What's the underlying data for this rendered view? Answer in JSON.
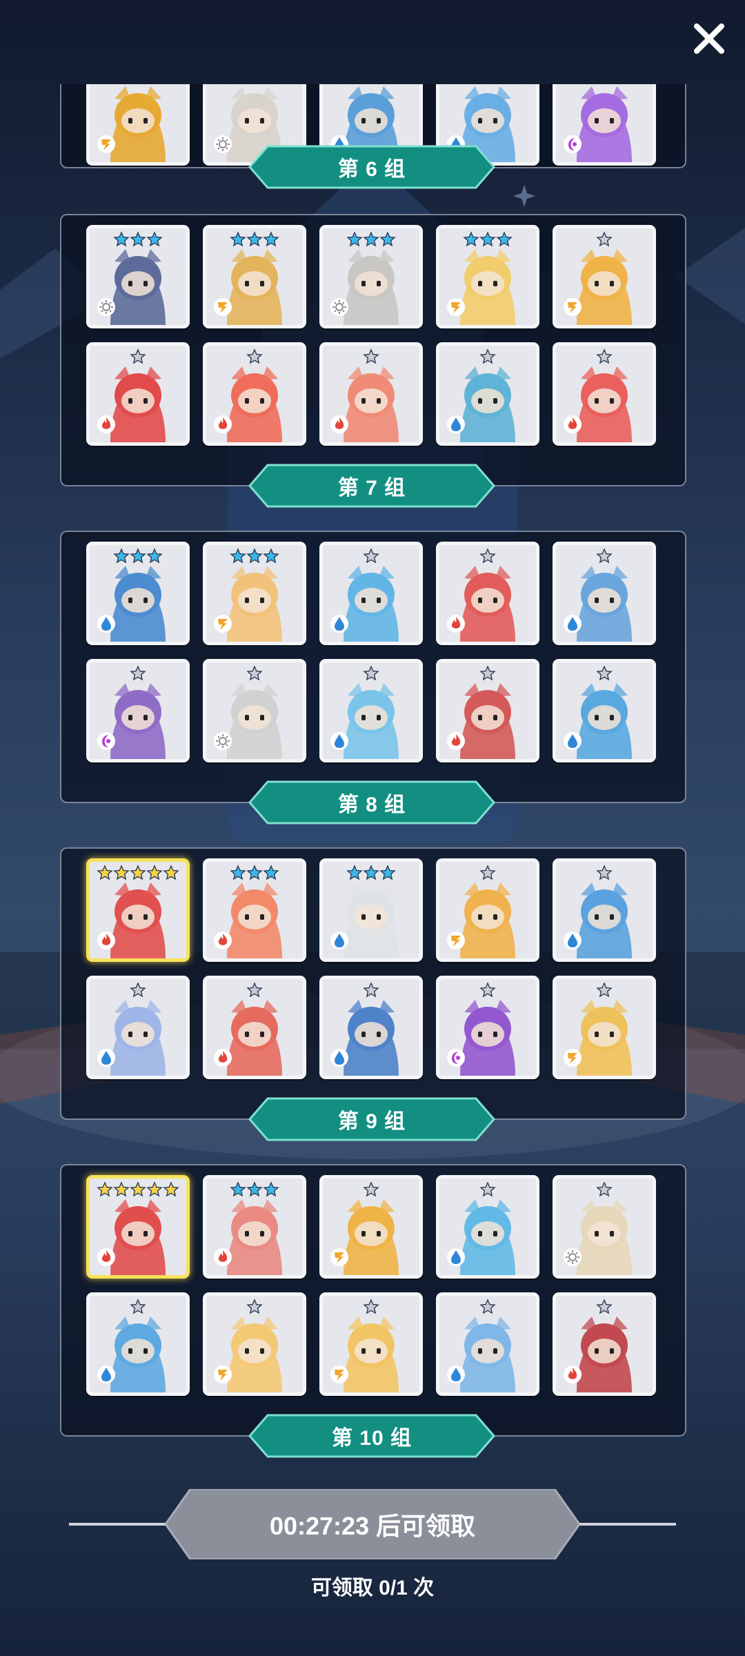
{
  "close_icon": "close-icon",
  "groups": [
    {
      "label": "第 6 组",
      "rows": [
        [
          {
            "el": "lightning",
            "body": "#e6a933",
            "stars": 0
          },
          {
            "el": "light",
            "body": "#d8d4cc",
            "stars": 0
          },
          {
            "el": "water",
            "body": "#5a9fd8",
            "stars": 0
          },
          {
            "el": "water",
            "body": "#6aaee6",
            "stars": 0
          },
          {
            "el": "dark",
            "body": "#a56be0",
            "stars": 0
          }
        ]
      ]
    },
    {
      "label": "第 7 组",
      "rows": [
        [
          {
            "el": "light",
            "body": "#5d6b9a",
            "stars": 3,
            "star": "blue"
          },
          {
            "el": "lightning",
            "body": "#e4b45c",
            "stars": 3,
            "star": "blue"
          },
          {
            "el": "light",
            "body": "#c9c7c4",
            "stars": 3,
            "star": "blue"
          },
          {
            "el": "lightning",
            "body": "#f2cd6d",
            "stars": 3,
            "star": "blue"
          },
          {
            "el": "lightning",
            "body": "#f0b347",
            "stars": 1,
            "star": "silver"
          }
        ],
        [
          {
            "el": "fire",
            "body": "#e24b4b",
            "stars": 1,
            "star": "silver"
          },
          {
            "el": "fire",
            "body": "#ef6d5a",
            "stars": 1,
            "star": "silver"
          },
          {
            "el": "fire",
            "body": "#f08b77",
            "stars": 1,
            "star": "silver"
          },
          {
            "el": "water",
            "body": "#5fb3d6",
            "stars": 1,
            "star": "silver"
          },
          {
            "el": "fire",
            "body": "#e9605c",
            "stars": 1,
            "star": "silver"
          }
        ]
      ]
    },
    {
      "label": "第 8 组",
      "rows": [
        [
          {
            "el": "water",
            "body": "#4c8cd0",
            "stars": 3,
            "star": "blue"
          },
          {
            "el": "lightning",
            "body": "#f2c27b",
            "stars": 3,
            "star": "blue"
          },
          {
            "el": "water",
            "body": "#63b5e6",
            "stars": 1,
            "star": "silver"
          },
          {
            "el": "fire",
            "body": "#e35c5c",
            "stars": 1,
            "star": "silver"
          },
          {
            "el": "water",
            "body": "#6aa6dd",
            "stars": 1,
            "star": "silver"
          }
        ],
        [
          {
            "el": "dark",
            "body": "#8f6cc7",
            "stars": 1,
            "star": "silver"
          },
          {
            "el": "light",
            "body": "#d1d1d1",
            "stars": 1,
            "star": "silver"
          },
          {
            "el": "water",
            "body": "#7ac4ea",
            "stars": 1,
            "star": "silver"
          },
          {
            "el": "fire",
            "body": "#d45a5a",
            "stars": 1,
            "star": "silver"
          },
          {
            "el": "water",
            "body": "#5aa8e0",
            "stars": 1,
            "star": "silver"
          }
        ]
      ]
    },
    {
      "label": "第 9 组",
      "rows": [
        [
          {
            "el": "fire",
            "body": "#e0514f",
            "stars": 5,
            "star": "gold",
            "gold": true
          },
          {
            "el": "fire",
            "body": "#f28a6a",
            "stars": 3,
            "star": "blue"
          },
          {
            "el": "water",
            "body": "#e0e3e6",
            "stars": 3,
            "star": "blue"
          },
          {
            "el": "lightning",
            "body": "#f0b24c",
            "stars": 1,
            "star": "silver"
          },
          {
            "el": "water",
            "body": "#5aa2df",
            "stars": 1,
            "star": "silver"
          }
        ],
        [
          {
            "el": "water",
            "body": "#9fb5e8",
            "stars": 1,
            "star": "silver"
          },
          {
            "el": "fire",
            "body": "#e66b5f",
            "stars": 1,
            "star": "silver"
          },
          {
            "el": "water",
            "body": "#4f83c9",
            "stars": 1,
            "star": "silver"
          },
          {
            "el": "dark",
            "body": "#9358d0",
            "stars": 1,
            "star": "silver"
          },
          {
            "el": "lightning",
            "body": "#efc15a",
            "stars": 1,
            "star": "silver"
          }
        ]
      ]
    },
    {
      "label": "第 10 组",
      "rows": [
        [
          {
            "el": "fire",
            "body": "#e14e4e",
            "stars": 5,
            "star": "gold",
            "gold": true
          },
          {
            "el": "fire",
            "body": "#e98a83",
            "stars": 3,
            "star": "blue"
          },
          {
            "el": "lightning",
            "body": "#efb447",
            "stars": 1,
            "star": "silver"
          },
          {
            "el": "water",
            "body": "#62b9e6",
            "stars": 1,
            "star": "silver"
          },
          {
            "el": "light",
            "body": "#e5d7b8",
            "stars": 1,
            "star": "silver"
          }
        ],
        [
          {
            "el": "water",
            "body": "#5fa9e2",
            "stars": 1,
            "star": "silver"
          },
          {
            "el": "lightning",
            "body": "#f4c975",
            "stars": 1,
            "star": "silver"
          },
          {
            "el": "lightning",
            "body": "#f1c565",
            "stars": 1,
            "star": "silver"
          },
          {
            "el": "water",
            "body": "#7fb7e8",
            "stars": 1,
            "star": "silver"
          },
          {
            "el": "fire",
            "body": "#c2494f",
            "stars": 1,
            "star": "silver"
          }
        ]
      ]
    }
  ],
  "timer": {
    "text": "00:27:23 后可领取"
  },
  "claim": {
    "text": "可领取 0/1 次"
  },
  "colors": {
    "label_fill": "#138f82",
    "label_edge": "#7fe1d1",
    "timer_fill": "#8b8f99",
    "star_blue": "#3bb8e8",
    "star_gold": "#f5d24a",
    "star_silver": "#c9ccd3"
  }
}
